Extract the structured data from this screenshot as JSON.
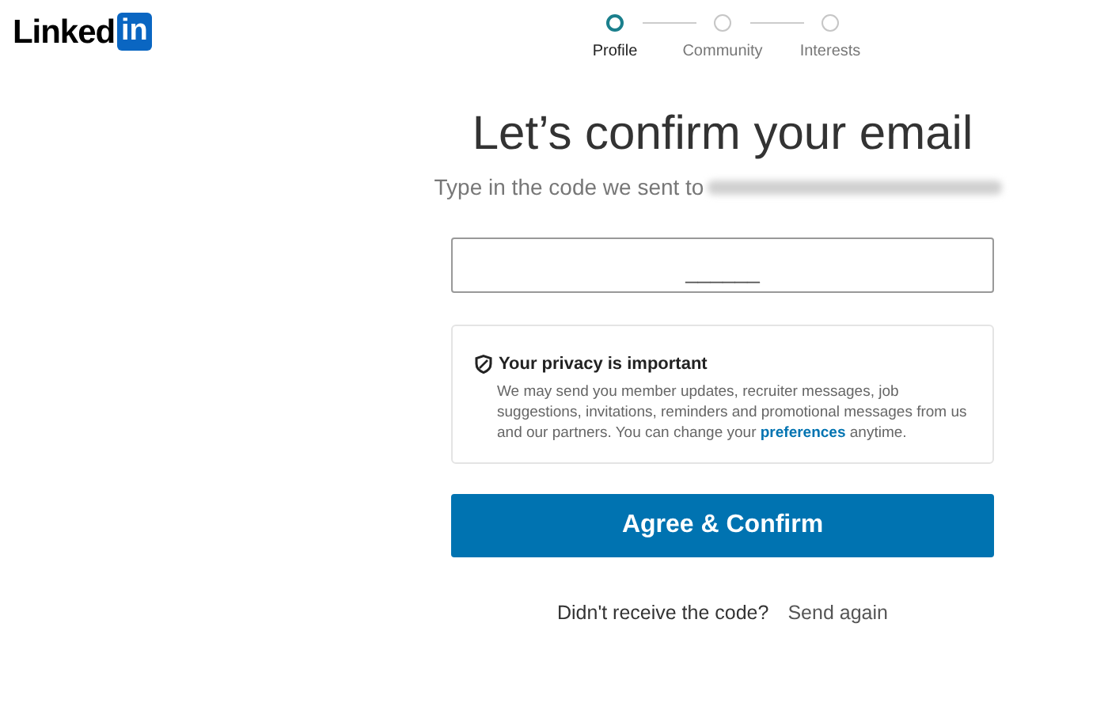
{
  "logo": {
    "text": "Linked",
    "badge": "in"
  },
  "steps": [
    {
      "label": "Profile",
      "selected": true
    },
    {
      "label": "Community",
      "selected": false
    },
    {
      "label": "Interests",
      "selected": false
    }
  ],
  "heading": "Let’s confirm your email",
  "subtitle": "Type in the code we sent to",
  "code_field": {
    "placeholder": "______"
  },
  "privacy": {
    "title": "Your privacy is important",
    "body": "We may send you member updates, recruiter messages, job suggestions, invitations, reminders and promotional messages from us and our partners. You can change your",
    "link": "preferences",
    "body_end": "anytime."
  },
  "confirm_button": "Agree & Confirm",
  "resend": {
    "prompt": "Didn't receive the code?",
    "link": "Send again"
  }
}
